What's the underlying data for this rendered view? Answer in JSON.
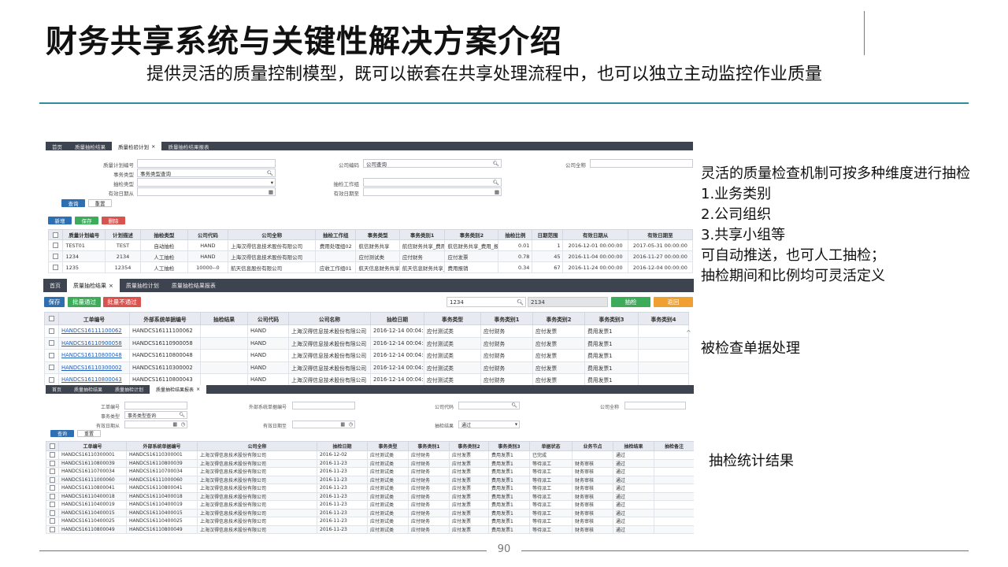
{
  "slide": {
    "title": "财务共享系统与关键性解决方案介绍",
    "subtitle": "提供灵活的质量控制模型，既可以嵌套在共享处理流程中，也可以独立主动监控作业质量",
    "page_number": "90"
  },
  "panel1": {
    "tabs": [
      {
        "label": "首页",
        "close": ""
      },
      {
        "label": "质量抽检结果",
        "close": ""
      },
      {
        "label": "质量检验计划",
        "close": "×"
      },
      {
        "label": "质量抽检结果报表",
        "close": ""
      }
    ],
    "fields": {
      "plan_code": {
        "label": "质量计划编号",
        "value": ""
      },
      "company_code": {
        "label": "公司编码",
        "value": "公司查询"
      },
      "company_name": {
        "label": "公司全称",
        "value": ""
      },
      "doc_type": {
        "label": "事务类型",
        "value": "事务类型查询"
      },
      "check_type": {
        "label": "抽检类型",
        "value": ""
      },
      "check_group": {
        "label": "抽检工作组",
        "value": ""
      },
      "valid_from": {
        "label": "有效日期从",
        "value": ""
      },
      "valid_to": {
        "label": "有效日期至",
        "value": ""
      }
    },
    "buttons": {
      "query": "查询",
      "reset": "重置",
      "add": "新增",
      "save": "保存",
      "delete": "删除"
    },
    "columns": [
      "",
      "质量计划编号",
      "计划描述",
      "抽检类型",
      "公司代码",
      "公司全称",
      "抽检工作组",
      "事务类型",
      "事务类别1",
      "事务类别2",
      "抽检比例",
      "日期范围",
      "有效日期从",
      "有效日期至"
    ],
    "rows": [
      [
        "TEST01",
        "TEST",
        "自动抽检",
        "HAND",
        "上海汉得信息技术股份有限公司",
        "费用处理组02",
        "航信财务共享",
        "航信财务共享_费用",
        "航信财务共享_费用_报销",
        "0.01",
        "1",
        "2016-12-01 00:00:00",
        "2017-05-31 00:00:00"
      ],
      [
        "1234",
        "2134",
        "人工抽检",
        "HAND",
        "上海汉得信息技术股份有限公司",
        "",
        "应付测试类",
        "应付财务",
        "应付发票",
        "0.78",
        "45",
        "2016-11-04 00:00:00",
        "2016-11-27 00:00:00"
      ],
      [
        "1235",
        "12354",
        "人工抽检",
        "10000--0",
        "航天信息股份有限公司",
        "应收工作组01",
        "航天信息财务共享事务类型",
        "航天信息财务共享_AP",
        "费用报销",
        "0.34",
        "67",
        "2016-11-24 00:00:00",
        "2016-12-04 00:00:00"
      ]
    ]
  },
  "panel2": {
    "tabs": [
      {
        "label": "首页",
        "close": ""
      },
      {
        "label": "质量抽检结果",
        "close": "×"
      },
      {
        "label": "质量抽检计划",
        "close": ""
      },
      {
        "label": "质量抽检结果报表",
        "close": ""
      }
    ],
    "buttons": {
      "save": "保存",
      "batch_pass": "批量通过",
      "batch_fail": "批量不通过",
      "check": "抽检",
      "back": "返回"
    },
    "search_value": "1234",
    "search_result": "2134",
    "columns": [
      "",
      "工单编号",
      "外部系统单据编号",
      "抽检结果",
      "公司代码",
      "公司名称",
      "抽检日期",
      "事务类型",
      "事务类别1",
      "事务类别2",
      "事务类别3",
      "事务类别4"
    ],
    "rows": [
      [
        "HANDCS16111100062",
        "HANDCS16111100062",
        "",
        "HAND",
        "上海汉得信息技术股份有限公司",
        "2016-12-14 00:04:57",
        "应付测试类",
        "应付财务",
        "应付发票",
        "费用发票1",
        ""
      ],
      [
        "HANDCS16110900058",
        "HANDCS16110900058",
        "",
        "HAND",
        "上海汉得信息技术股份有限公司",
        "2016-12-14 00:04:57",
        "应付测试类",
        "应付财务",
        "应付发票",
        "费用发票1",
        ""
      ],
      [
        "HANDCS16110800048",
        "HANDCS16110800048",
        "",
        "HAND",
        "上海汉得信息技术股份有限公司",
        "2016-12-14 00:04:57",
        "应付测试类",
        "应付财务",
        "应付发票",
        "费用发票1",
        ""
      ],
      [
        "HANDCS16110300002",
        "HANDCS16110300002",
        "",
        "HAND",
        "上海汉得信息技术股份有限公司",
        "2016-12-14 00:04:57",
        "应付测试类",
        "应付财务",
        "应付发票",
        "费用发票1",
        ""
      ],
      [
        "HANDCS16110800043",
        "HANDCS16110800043",
        "",
        "HAND",
        "上海汉得信息技术股份有限公司",
        "2016-12-14 00:04:57",
        "应付测试类",
        "应付财务",
        "应付发票",
        "费用发票1",
        ""
      ]
    ]
  },
  "panel3": {
    "tabs": [
      {
        "label": "首页",
        "close": ""
      },
      {
        "label": "质量抽检结果",
        "close": ""
      },
      {
        "label": "质量抽检计划",
        "close": ""
      },
      {
        "label": "质量抽检结果报表",
        "close": "×"
      }
    ],
    "fields": {
      "order_no": {
        "label": "工单编号",
        "value": ""
      },
      "ext_no": {
        "label": "外部系统单据编号",
        "value": ""
      },
      "company_code": {
        "label": "公司代码",
        "value": ""
      },
      "company_name": {
        "label": "公司全称",
        "value": ""
      },
      "doc_type": {
        "label": "事务类型",
        "value": "事务类型查询"
      },
      "valid_from": {
        "label": "有效日期从",
        "value": ""
      },
      "valid_to": {
        "label": "有效日期至",
        "value": ""
      },
      "check_result": {
        "label": "抽检结果",
        "value": "通过"
      }
    },
    "buttons": {
      "query": "查询",
      "reset": "重置"
    },
    "columns": [
      "",
      "工单编号",
      "外部系统单据编号",
      "公司全称",
      "抽检日期",
      "事务类型",
      "事务类别1",
      "事务类别2",
      "事务类别3",
      "单据状态",
      "业务节点",
      "抽检结果",
      "抽检备注"
    ],
    "rows": [
      [
        "HANDCS16110300001",
        "HANDCS16110300001",
        "上海汉得信息技术股份有限公司",
        "2016-12-02",
        "应付测试类",
        "应付财务",
        "应付发票",
        "费用发票1",
        "已完成",
        "",
        "通过",
        ""
      ],
      [
        "HANDCS16110800039",
        "HANDCS16110800039",
        "上海汉得信息技术股份有限公司",
        "2016-11-23",
        "应付测试类",
        "应付财务",
        "应付发票",
        "费用发票1",
        "等待派工",
        "财务审核",
        "通过",
        ""
      ],
      [
        "HANDCS16110700034",
        "HANDCS16110700034",
        "上海汉得信息技术股份有限公司",
        "2016-11-23",
        "应付测试类",
        "应付财务",
        "应付发票",
        "费用发票1",
        "等待派工",
        "财务审核",
        "通过",
        ""
      ],
      [
        "HANDCS16111000060",
        "HANDCS16111000060",
        "上海汉得信息技术股份有限公司",
        "2016-11-23",
        "应付测试类",
        "应付财务",
        "应付发票",
        "费用发票1",
        "等待派工",
        "财务审核",
        "通过",
        ""
      ],
      [
        "HANDCS16110800041",
        "HANDCS16110800041",
        "上海汉得信息技术股份有限公司",
        "2016-11-23",
        "应付测试类",
        "应付财务",
        "应付发票",
        "费用发票1",
        "等待派工",
        "财务审核",
        "通过",
        ""
      ],
      [
        "HANDCS16110400018",
        "HANDCS16110400018",
        "上海汉得信息技术股份有限公司",
        "2016-11-23",
        "应付测试类",
        "应付财务",
        "应付发票",
        "费用发票1",
        "等待派工",
        "财务审核",
        "通过",
        ""
      ],
      [
        "HANDCS16110400019",
        "HANDCS16110400019",
        "上海汉得信息技术股份有限公司",
        "2016-11-23",
        "应付测试类",
        "应付财务",
        "应付发票",
        "费用发票1",
        "等待派工",
        "财务审核",
        "通过",
        ""
      ],
      [
        "HANDCS16110400015",
        "HANDCS16110400015",
        "上海汉得信息技术股份有限公司",
        "2016-11-23",
        "应付测试类",
        "应付财务",
        "应付发票",
        "费用发票1",
        "等待派工",
        "财务审核",
        "通过",
        ""
      ],
      [
        "HANDCS16110400025",
        "HANDCS16110400025",
        "上海汉得信息技术股份有限公司",
        "2016-11-23",
        "应付测试类",
        "应付财务",
        "应付发票",
        "费用发票1",
        "等待派工",
        "财务审核",
        "通过",
        ""
      ],
      [
        "HANDCS16110800049",
        "HANDCS16110800049",
        "上海汉得信息技术股份有限公司",
        "2016-11-23",
        "应付测试类",
        "应付财务",
        "应付发票",
        "费用发票1",
        "等待派工",
        "财务审核",
        "通过",
        ""
      ]
    ]
  },
  "side": {
    "block1": [
      "灵活的质量检查机制可按多种维度进行抽检",
      "1.业务类别",
      "2.公司组织",
      "3.共享小组等",
      "可自动推送，也可人工抽检；",
      "抽检期间和比例均可灵活定义"
    ],
    "block2": "被检查单据处理",
    "block3": "抽检统计结果"
  },
  "colors": {
    "accent_line": "#2f8c98",
    "tabbar": "#3e4350",
    "primary": "#2d6fb3",
    "success": "#3cab5a",
    "danger": "#d9534f",
    "warning": "#f0a032"
  },
  "icons": [
    "search-icon",
    "dropdown-caret-icon",
    "calendar-icon",
    "clock-icon",
    "close-icon",
    "scroll-up-icon"
  ]
}
